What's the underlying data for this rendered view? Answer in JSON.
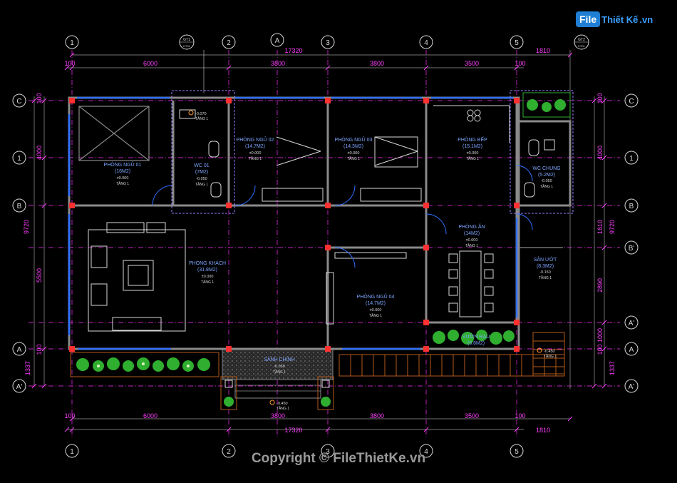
{
  "brand": {
    "logo_part1": "File",
    "logo_part2": "Thiết Kế",
    "logo_part3": ".vn"
  },
  "copyright": "Copyright © FileThietKe.vn",
  "grid": {
    "columns": [
      "1",
      "2",
      "A",
      "3",
      "4",
      "5"
    ],
    "rows": [
      "C",
      "1",
      "B",
      "B'",
      "A'",
      "A",
      "A'"
    ],
    "section_tags": [
      "GT1",
      "GT2"
    ],
    "section_sub": "KT01"
  },
  "dimensions": {
    "total_width": "17320",
    "right_ext": "1810",
    "end": "100",
    "spans": [
      "6000",
      "3800",
      "3800",
      "3500"
    ],
    "left_total": "9720",
    "left_rows": [
      "4000",
      "5500",
      "1337"
    ],
    "right_rows": [
      "4000",
      "1610",
      "2890",
      "1000",
      "1337"
    ],
    "small_100": "100"
  },
  "rooms": [
    {
      "name": "PHÒNG NGỦ 01",
      "area": "(16M2)",
      "level": "±0.000",
      "floor": "TẦNG 1"
    },
    {
      "name": "WC 01",
      "area": "(7M2)",
      "level": "-0.050",
      "floor": "TẦNG 1"
    },
    {
      "name": "PHÒNG NGỦ 02",
      "area": "(14.7M2)",
      "level": "±0.000",
      "floor": "TẦNG 1"
    },
    {
      "name": "PHÒNG NGỦ 03",
      "area": "(14.3M2)",
      "level": "±0.000",
      "floor": "TẦNG 1"
    },
    {
      "name": "PHÒNG BẾP",
      "area": "(15.1M2)",
      "level": "±0.000",
      "floor": "TẦNG 1"
    },
    {
      "name": "WC CHUNG",
      "area": "(5.2M2)",
      "level": "-0.050",
      "floor": "TẦNG 1"
    },
    {
      "name": "PHÒNG ĂN",
      "area": "(14M2)",
      "level": "±0.000",
      "floor": "TẦNG 1"
    },
    {
      "name": "SÂN ƯỚT",
      "area": "(8.3M2)",
      "level": "-0.150",
      "floor": "TẦNG 1"
    },
    {
      "name": "PHÒNG KHÁCH",
      "area": "(31.8M2)",
      "level": "±0.000",
      "floor": "TẦNG 1"
    },
    {
      "name": "PHÒNG NGỦ 04",
      "area": "(14.7M2)",
      "level": "±0.000",
      "floor": "TẦNG 1"
    },
    {
      "name": "VƯỜN RAU",
      "area": "(3.6M2)",
      "level": "",
      "floor": ""
    },
    {
      "name": "SẢNH CHÍNH",
      "area": "",
      "level": "-0.050",
      "floor": "TẦNG 1"
    }
  ],
  "spot_levels": [
    {
      "level": "-0.070",
      "floor": "TẦNG 1"
    },
    {
      "level": "-0.450",
      "floor": "TẦNG 1"
    },
    {
      "level": "-0.450",
      "floor": "TẦNG 1"
    }
  ],
  "colors": {
    "background": "#000000",
    "wall": "#8a8a8a",
    "column": "#ff3030",
    "axis": "#ff30ff",
    "dim": "#ff40ff",
    "room_label": "#7ea6ff",
    "bubble": "#d8d8d8",
    "window": "#2f6fff",
    "plant": "#2fae2f",
    "deck": "#b35a1a",
    "brand": "#1f7fd4",
    "watermark": "#9a9a9a"
  }
}
